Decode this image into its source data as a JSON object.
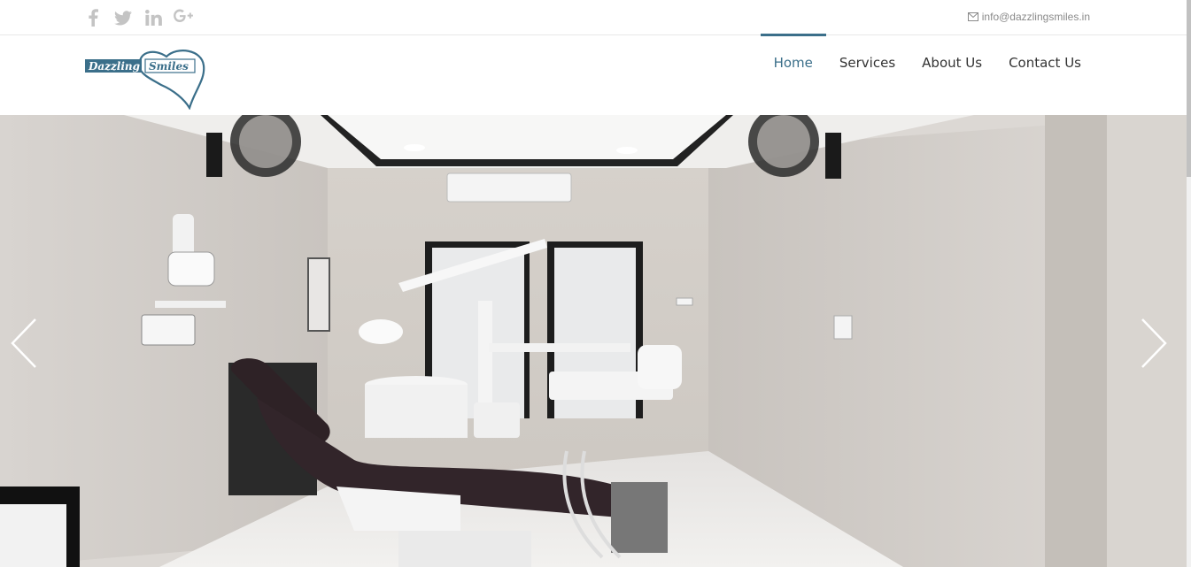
{
  "topbar": {
    "social": [
      {
        "icon": "facebook-icon"
      },
      {
        "icon": "twitter-icon"
      },
      {
        "icon": "linkedin-icon"
      },
      {
        "icon": "google-plus-icon"
      }
    ],
    "email": "info@dazzlingsmiles.in"
  },
  "logo": {
    "word1": "Dazzling",
    "word2": "Smiles",
    "color": "#3b6f8a"
  },
  "nav": {
    "items": [
      {
        "label": "Home",
        "active": true
      },
      {
        "label": "Services",
        "active": false
      },
      {
        "label": "About Us",
        "active": false
      },
      {
        "label": "Contact Us",
        "active": false
      }
    ]
  },
  "slider": {
    "image": "dental-clinic-photo",
    "prev_icon": "chevron-left-icon",
    "next_icon": "chevron-right-icon"
  }
}
